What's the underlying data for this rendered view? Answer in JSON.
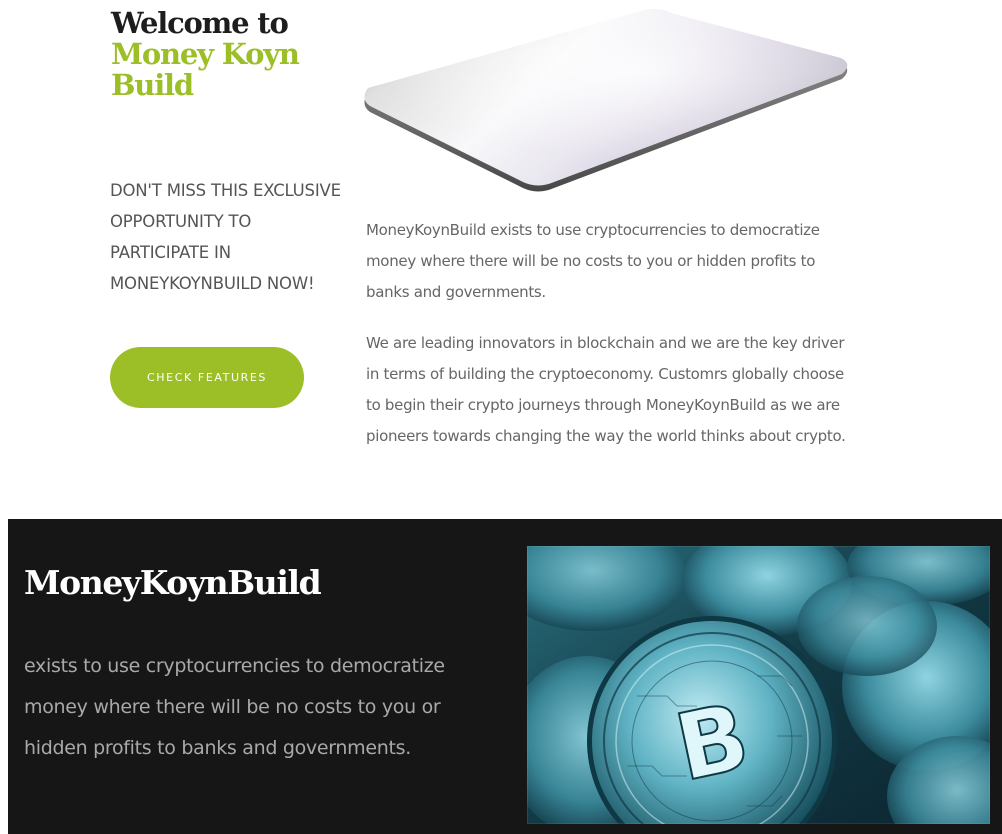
{
  "hero": {
    "welcome_line1": "Welcome to",
    "welcome_line2": "Money Koyn Build",
    "promo_text": "DON'T MISS THIS EXCLUSIVE OPPORTUNITY TO PARTICIPATE IN MONEYKOYNBUILD NOW!",
    "cta_label": "CHECK FEATURES"
  },
  "about": {
    "paragraph1": "MoneyKoynBuild exists to use cryptocurrencies to democratize money where there will be no costs to you or hidden profits to banks and governments.",
    "paragraph2": "We are leading innovators in blockchain and we are the key driver in terms of building the cryptoeconomy. Customrs globally choose to begin their crypto journeys through MoneyKoynBuild as we are pioneers towards changing the way the world thinks about crypto."
  },
  "dark_section": {
    "title": "MoneyKoynBuild",
    "text": "exists to use cryptocurrencies to democratize money where there will be no costs to you or hidden profits to banks and governments.",
    "coin_letter": "B"
  },
  "colors": {
    "accent": "#9cbf27",
    "heading": "#1d1d1d",
    "body_text": "#666666",
    "dark_bg": "#161616"
  }
}
